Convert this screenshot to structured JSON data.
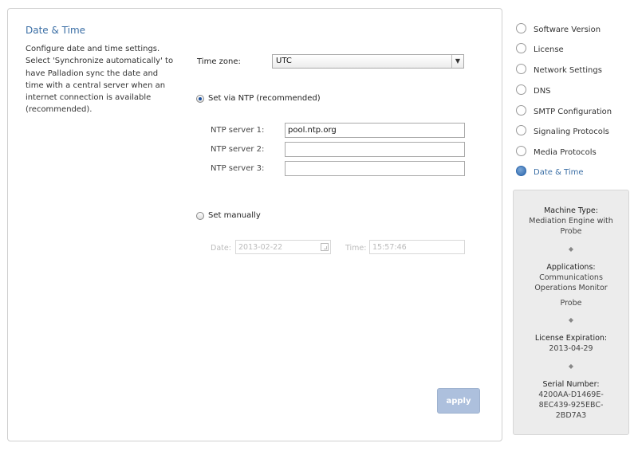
{
  "section": {
    "title": "Date & Time",
    "description": "Configure date and time settings. Select 'Synchronize automatically' to have Palladion sync the date and time with a central server when an internet connection is available (recommended)."
  },
  "form": {
    "timezone_label": "Time zone:",
    "timezone_value": "UTC",
    "ntp_radio_label": "Set via NTP (recommended)",
    "ntp_radio_selected": true,
    "ntp_servers": [
      {
        "label": "NTP server 1:",
        "value": "pool.ntp.org"
      },
      {
        "label": "NTP server 2:",
        "value": ""
      },
      {
        "label": "NTP server 3:",
        "value": ""
      }
    ],
    "manual_radio_label": "Set manually",
    "manual_radio_selected": false,
    "date_label": "Date:",
    "date_value": "2013-02-22",
    "time_label": "Time:",
    "time_value": "15:57:46",
    "apply_label": "apply"
  },
  "steps": [
    {
      "label": "Software Version",
      "active": false
    },
    {
      "label": "License",
      "active": false
    },
    {
      "label": "Network Settings",
      "active": false
    },
    {
      "label": "DNS",
      "active": false
    },
    {
      "label": "SMTP Configuration",
      "active": false
    },
    {
      "label": "Signaling Protocols",
      "active": false
    },
    {
      "label": "Media Protocols",
      "active": false
    },
    {
      "label": "Date & Time",
      "active": true
    }
  ],
  "info": {
    "machine_type_label": "Machine Type:",
    "machine_type_value_1": "Mediation Engine with",
    "machine_type_value_2": "Probe",
    "applications_label": "Applications:",
    "applications_value_1": "Communications",
    "applications_value_2": "Operations Monitor",
    "applications_value_3": "Probe",
    "license_label": "License Expiration:",
    "license_value": "2013-04-29",
    "serial_label": "Serial Number:",
    "serial_value_1": "4200AA-D1469E-",
    "serial_value_2": "8EC439-925EBC-",
    "serial_value_3": "2BD7A3",
    "separator": "◆"
  }
}
